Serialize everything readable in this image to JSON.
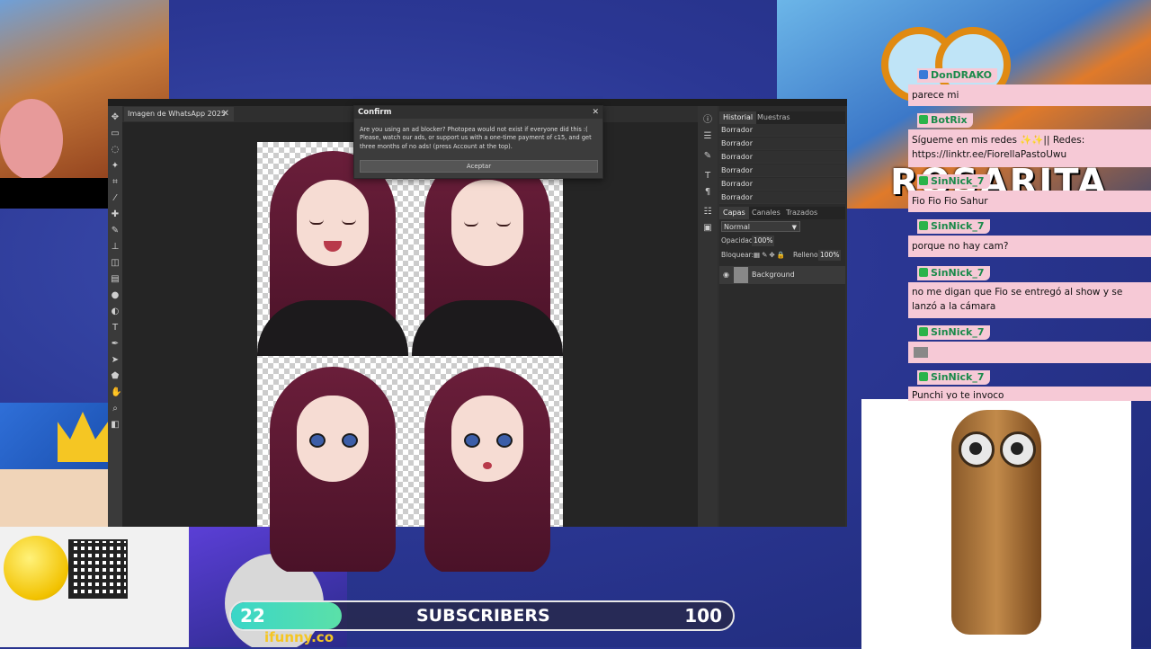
{
  "overlay": {
    "banner_text": "ROSARITA",
    "ifunny_text": "ifunny.co"
  },
  "photopea": {
    "doc_tab": "Imagen de WhatsApp 2025",
    "history_tabs": [
      "Historial",
      "Muestras"
    ],
    "history_items": [
      "Borrador",
      "Borrador",
      "Borrador",
      "Borrador",
      "Borrador",
      "Borrador"
    ],
    "layer_tabs": [
      "Capas",
      "Canales",
      "Trazados"
    ],
    "blend_mode": "Normal",
    "opacity_label": "Opacidad:",
    "opacity_value": "100%",
    "lock_label": "Bloquear:",
    "fill_label": "Relleno:",
    "fill_value": "100%",
    "layer_name": "Background"
  },
  "dialog": {
    "title": "Confirm",
    "message": "Are you using an ad blocker? Photopea would not exist if everyone did this :( Please, watch our ads, or support us with a one-time payment of c15, and get three months of no ads! (press Account at the top).",
    "button": "Aceptar"
  },
  "chat": [
    {
      "user": "DonDRAKO",
      "text": "parece mi"
    },
    {
      "user": "BotRix",
      "text": "Sígueme en mis redes ✨✨|| Redes: https://linktr.ee/FiorellaPastoUwu"
    },
    {
      "user": "SinNick_7",
      "text": "Fio Fio Fio Sahur"
    },
    {
      "user": "SinNick_7",
      "text": "porque no hay cam?"
    },
    {
      "user": "SinNick_7",
      "text": "no me digan que Fio se entregó al show y se lanzó a la cámara"
    },
    {
      "user": "SinNick_7",
      "text": ""
    },
    {
      "user": "SinNick_7",
      "text": "Punchi yo te invoco"
    }
  ],
  "subs": {
    "current": "22",
    "label": "SUBSCRIBERS",
    "goal": "100",
    "progress": 0.22
  }
}
